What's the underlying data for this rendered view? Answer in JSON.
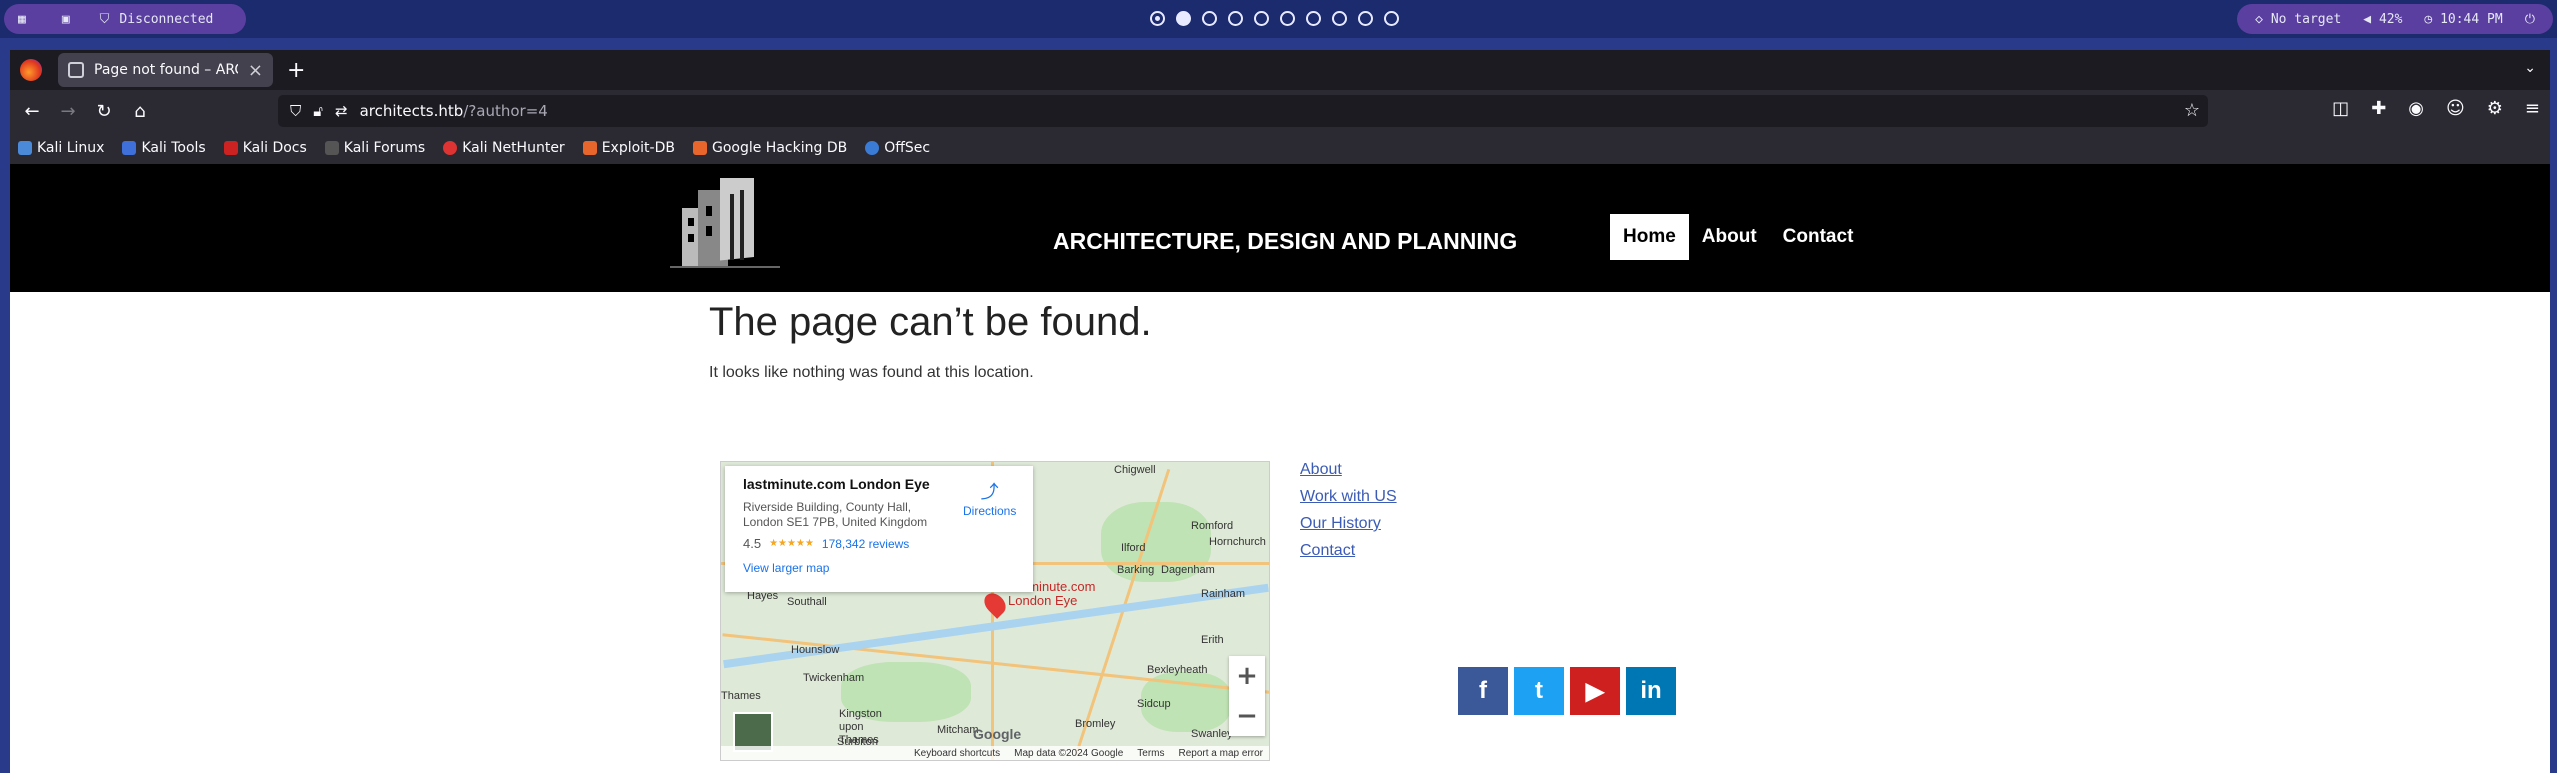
{
  "system_bar": {
    "vpn_status": "Disconnected",
    "target": "No target",
    "volume": "42%",
    "clock": "10:44 PM",
    "workspaces": 10,
    "active_workspace": 2
  },
  "browser": {
    "tab_title": "Page not found – ARCHITE",
    "url_host": "architects.htb",
    "url_path": "/?author=4",
    "bookmarks": [
      "Kali Linux",
      "Kali Tools",
      "Kali Docs",
      "Kali Forums",
      "Kali NetHunter",
      "Exploit-DB",
      "Google Hacking DB",
      "OffSec"
    ]
  },
  "site": {
    "title": "ARCHITECTURE, DESIGN AND PLANNING",
    "nav": [
      "Home",
      "About",
      "Contact"
    ],
    "active_nav": "Home"
  },
  "content": {
    "heading": "The page can’t be found.",
    "message": "It looks like nothing was found at this location."
  },
  "map": {
    "place_name": "lastminute.com London Eye",
    "address": "Riverside Building, County Hall, London SE1 7PB, United Kingdom",
    "rating": "4.5",
    "stars": "★★★★★",
    "reviews": "178,342 reviews",
    "directions": "Directions",
    "view_larger": "View larger map",
    "pin_label_1": "lastminute.com",
    "pin_label_2": "London Eye",
    "zoom_in": "+",
    "zoom_out": "−",
    "footer": [
      "Keyboard shortcuts",
      "Map data ©2024 Google",
      "Terms",
      "Report a map error"
    ],
    "google": "Google",
    "places": [
      "Chigwell",
      "Romford",
      "Hornchurch",
      "Ilford",
      "Barking",
      "Dagenham",
      "Rainham",
      "Erith",
      "Hayes",
      "Southall",
      "Hounslow",
      "Twickenham",
      "Bexleyheath",
      "Sidcup",
      "Bromley",
      "Kingston upon Thames",
      "Surbiton",
      "Mitcham",
      "Thames",
      "Swanley"
    ]
  },
  "footer_links": [
    "About",
    "Work with US",
    "Our History",
    "Contact"
  ],
  "social": [
    "f",
    "t",
    "▶",
    "in"
  ]
}
